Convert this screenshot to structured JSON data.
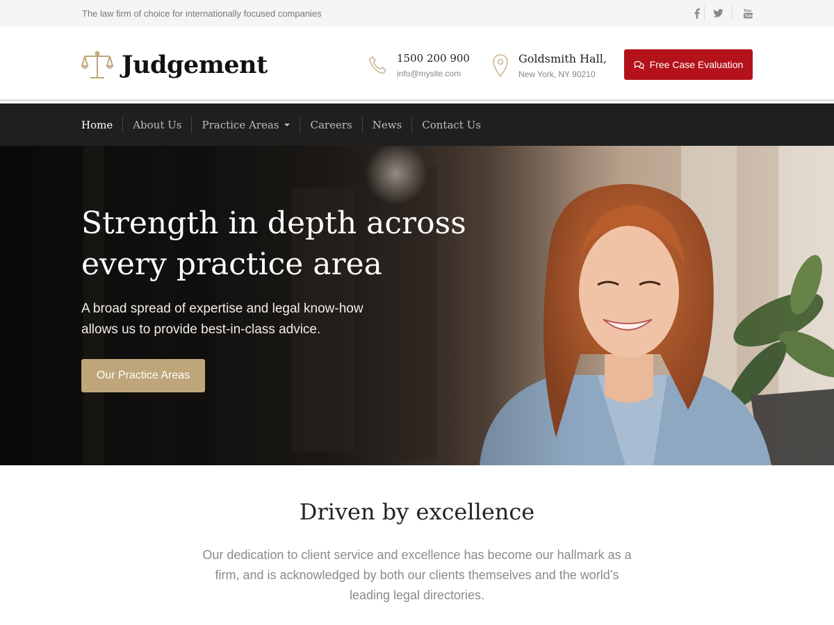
{
  "topbar": {
    "tagline": "The law firm of choice for internationally focused companies",
    "social": [
      {
        "icon": "facebook-icon"
      },
      {
        "icon": "twitter-icon"
      },
      {
        "icon": "youtube-icon"
      }
    ]
  },
  "header": {
    "logo_text": "Judgement",
    "logo_icon": "scales-icon",
    "phone": {
      "main": "1500 200 900",
      "sub": "info@mysite.com",
      "icon": "phone-icon"
    },
    "address": {
      "main": "Goldsmith Hall,",
      "sub": "New York, NY 90210",
      "icon": "map-pin-icon"
    },
    "cta_label": "Free Case Evaluation",
    "cta_icon": "chat-icon"
  },
  "nav": {
    "items": [
      {
        "label": "Home"
      },
      {
        "label": "About Us"
      },
      {
        "label": "Practice Areas"
      },
      {
        "label": "Careers"
      },
      {
        "label": "News"
      },
      {
        "label": "Contact Us"
      }
    ]
  },
  "hero": {
    "title": "Strength in depth across every practice area",
    "text": "A broad spread of expertise and legal know-how allows us to provide best-in-class advice.",
    "button_label": "Our Practice Areas"
  },
  "section": {
    "title": "Driven by excellence",
    "text": "Our dedication to client service and excellence has become our hallmark as a firm, and is acknowledged by both our clients themselves and the world’s leading legal directories."
  },
  "colors": {
    "accent_red": "#b4121b",
    "accent_gold": "#bfa57a",
    "nav_bg": "#1f1f1f",
    "topbar_bg": "#f5f5f5"
  }
}
